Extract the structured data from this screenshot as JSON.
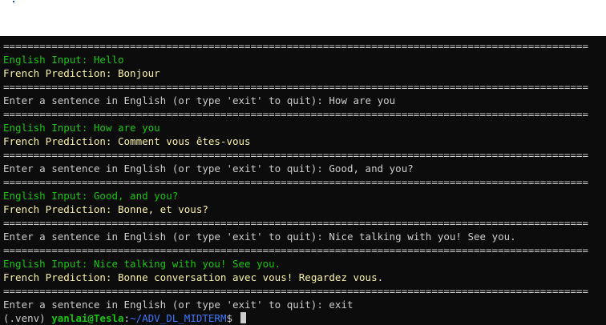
{
  "separator": "=================================================================================================",
  "blocks": [
    {
      "english_label": "English Input: ",
      "english": "Hello",
      "french_label": "French Prediction: ",
      "french": "Bonjour",
      "prompt": "Enter a sentence in English (or type 'exit' to quit): ",
      "response": "How are you"
    },
    {
      "english_label": "English Input: ",
      "english": "How are you",
      "french_label": "French Prediction: ",
      "french": "Comment vous êtes-vous",
      "prompt": "Enter a sentence in English (or type 'exit' to quit): ",
      "response": "Good, and you?"
    },
    {
      "english_label": "English Input: ",
      "english": "Good, and you?",
      "french_label": "French Prediction: ",
      "french": "Bonne, et vous?",
      "prompt": "Enter a sentence in English (or type 'exit' to quit): ",
      "response": "Nice talking with you! See you."
    },
    {
      "english_label": "English Input: ",
      "english": "Nice talking with you! See you.",
      "french_label": "French Prediction: ",
      "french": "Bonne conversation avec vous! Regardez vous.",
      "prompt": "Enter a sentence in English (or type 'exit' to quit): ",
      "response": "exit"
    }
  ],
  "shell_prompt": {
    "venv": "(.venv) ",
    "user_host": "yanlai@Tesla",
    "colon": ":",
    "path": "~/ADV_DL_MIDTERM",
    "dollar": "$ "
  },
  "colors": {
    "background": "#0c0c0c",
    "english": "#16c60c",
    "french": "#f9f1a5",
    "text": "#cccccc",
    "path": "#3b78ff"
  }
}
